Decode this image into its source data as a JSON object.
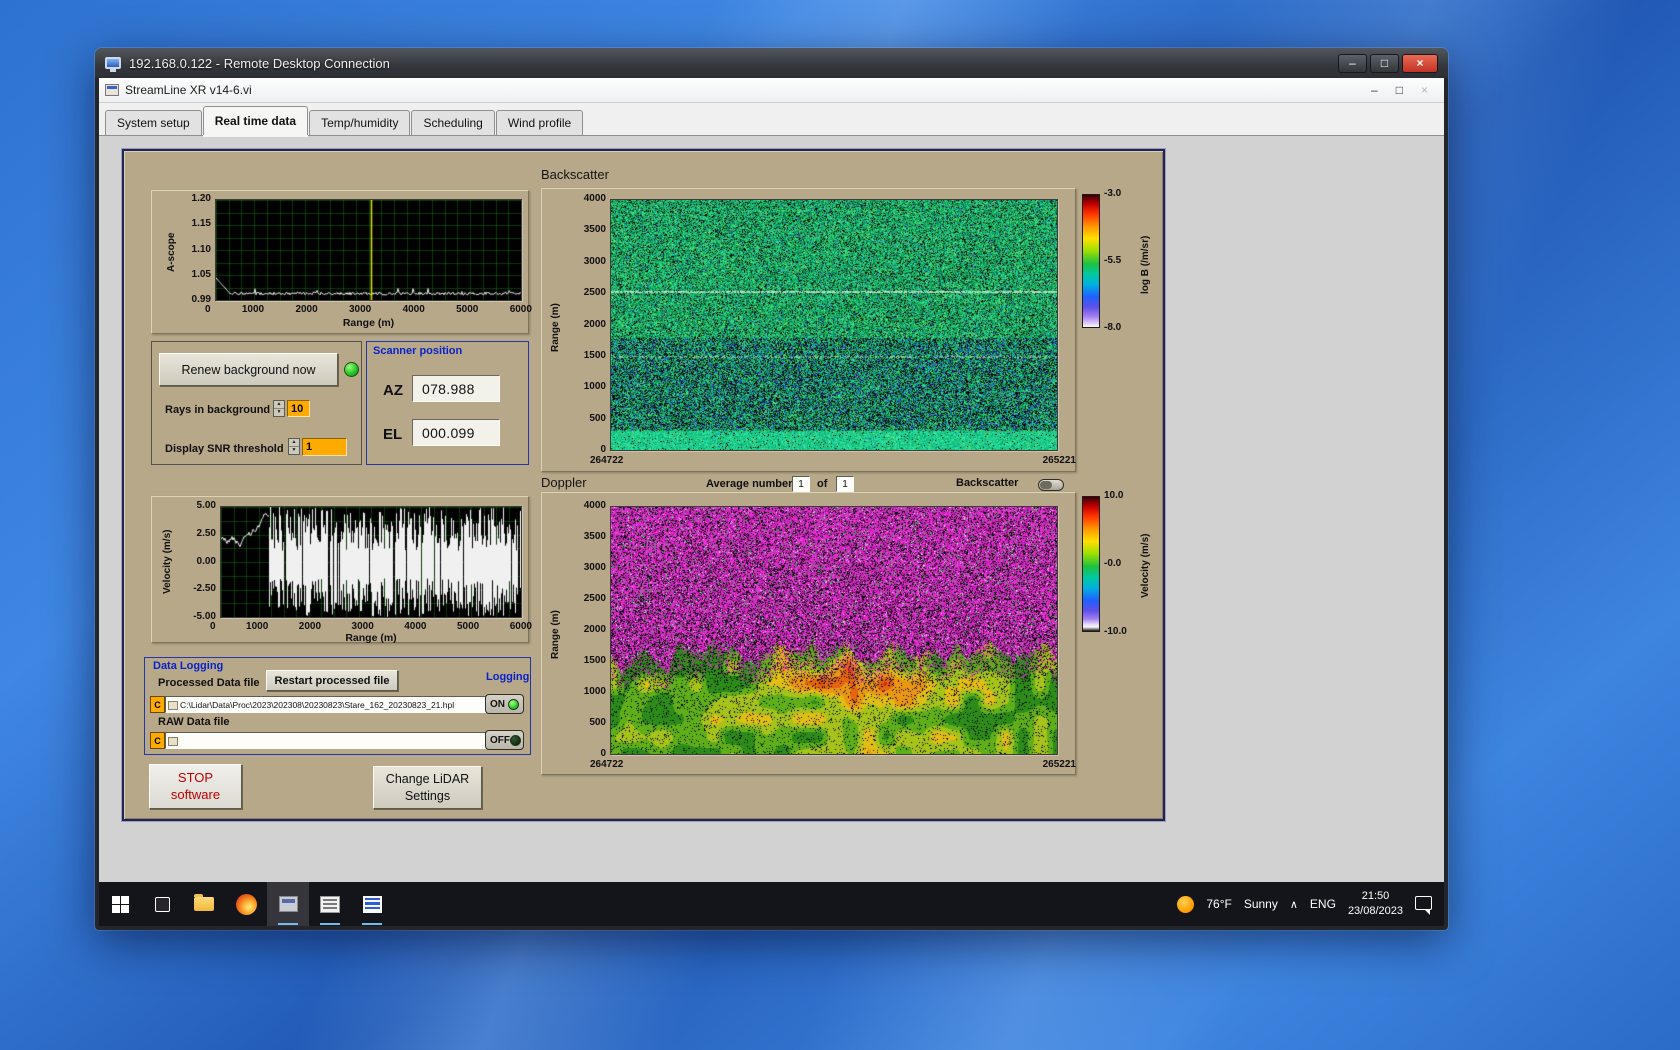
{
  "rdp": {
    "title": "192.168.0.122 - Remote Desktop Connection"
  },
  "app": {
    "title": "StreamLine XR v14-6.vi"
  },
  "icons": {
    "minimize": "–",
    "maximize": "□",
    "close": "×",
    "chevron_up": "∧",
    "spin_up": "▲",
    "spin_down": "▼"
  },
  "tabs": [
    {
      "label": "System setup"
    },
    {
      "label": "Real time data"
    },
    {
      "label": "Temp/humidity"
    },
    {
      "label": "Scheduling"
    },
    {
      "label": "Wind profile"
    }
  ],
  "ascope": {
    "ylabel": "A-scope",
    "xlabel": "Range (m)",
    "y_ticks": [
      "1.20",
      "1.15",
      "1.10",
      "1.05",
      "0.99"
    ],
    "x_ticks": [
      "0",
      "1000",
      "2000",
      "3000",
      "4000",
      "5000",
      "6000"
    ]
  },
  "controls": {
    "renew": "Renew background now",
    "rays_label": "Rays in background",
    "rays_value": "10",
    "snr_label": "Display SNR threshold",
    "snr_value": "1"
  },
  "scanner": {
    "title": "Scanner position",
    "az_label": "AZ",
    "az_value": "078.988",
    "el_label": "EL",
    "el_value": "000.099"
  },
  "backscatter": {
    "title": "Backscatter",
    "ylabel": "Range (m)",
    "y_ticks": [
      "4000",
      "3500",
      "3000",
      "2500",
      "2000",
      "1500",
      "1000",
      "500",
      "0"
    ],
    "x_left": "264722",
    "x_right": "265221",
    "colorbar": {
      "t": "-3.0",
      "m": "-5.5",
      "b": "-8.0",
      "label": "log B (/m/sr)"
    }
  },
  "doppler": {
    "title": "Doppler",
    "ylabel": "Range (m)",
    "y_ticks": [
      "4000",
      "3500",
      "3000",
      "2500",
      "2000",
      "1500",
      "1000",
      "500",
      "0"
    ],
    "x_left": "264722",
    "x_right": "265221",
    "avg_label": "Average number",
    "avg_value": "1",
    "of_label": "of",
    "avg_total": "1",
    "toggle_label": "Backscatter",
    "colorbar": {
      "t": "10.0",
      "m": "-0.0",
      "b": "-10.0",
      "label": "Velocity (m/s)"
    }
  },
  "velocity": {
    "ylabel": "Velocity (m/s)",
    "xlabel": "Range (m)",
    "y_ticks": [
      "5.00",
      "2.50",
      "0.00",
      "-2.50",
      "-5.00"
    ],
    "x_ticks": [
      "0",
      "1000",
      "2000",
      "3000",
      "4000",
      "5000",
      "6000"
    ]
  },
  "logging": {
    "title": "Data Logging",
    "processed_label": "Processed Data file",
    "restart_button": "Restart processed file",
    "drive": "C",
    "processed_path": "C:\\Lidar\\Data\\Proc\\2023\\202308\\20230823\\Stare_162_20230823_21.hpl",
    "raw_label": "RAW Data file",
    "raw_path": "",
    "logging_label": "Logging",
    "on_label": "ON",
    "off_label": "OFF"
  },
  "footer_buttons": {
    "stop_line1": "STOP",
    "stop_line2": "software",
    "change_line1": "Change LiDAR",
    "change_line2": "Settings"
  },
  "taskbar": {
    "temp": "76°F",
    "condition": "Sunny",
    "lang": "ENG",
    "time": "21:50",
    "date": "23/08/2023"
  }
}
